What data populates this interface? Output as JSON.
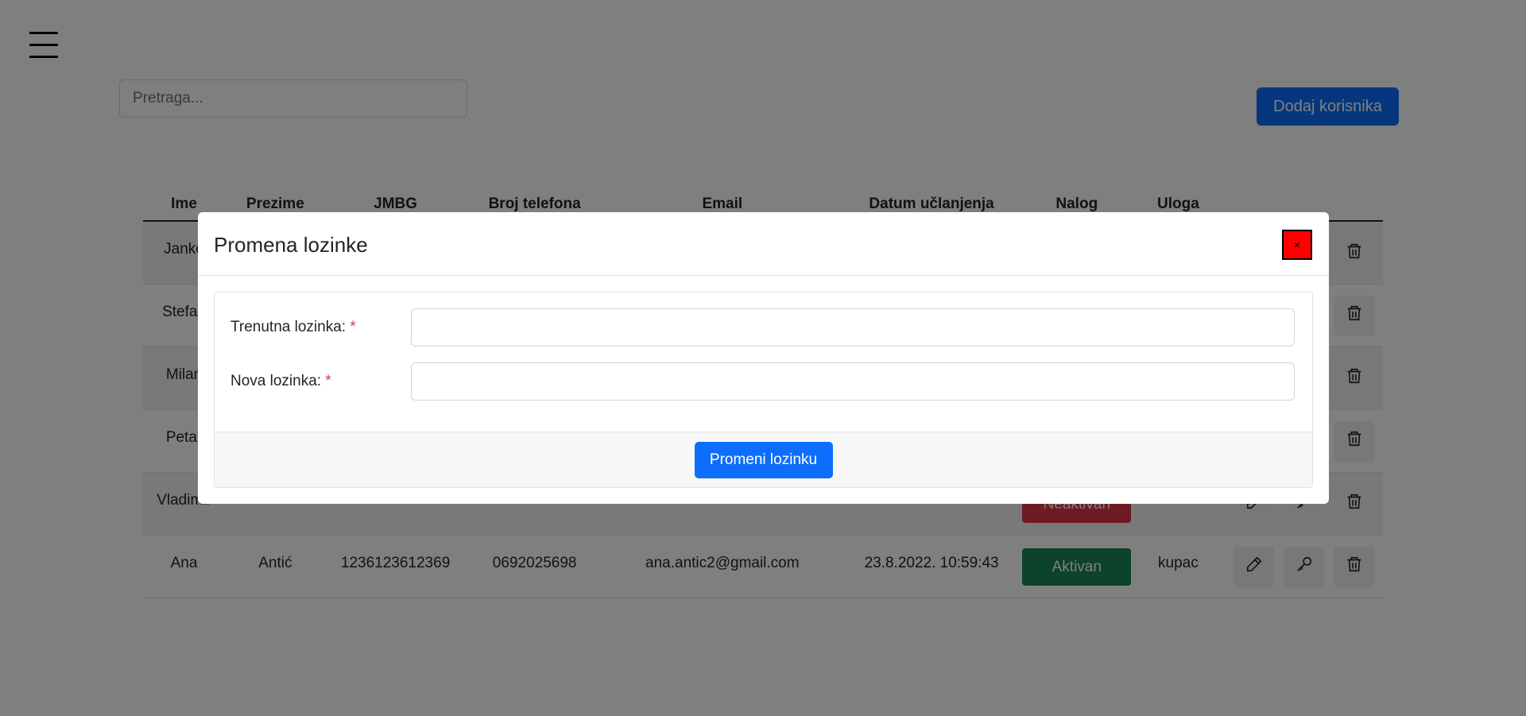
{
  "page": {
    "menu_icon": "hamburger-icon",
    "search_placeholder": "Pretraga...",
    "add_user_label": "Dodaj korisnika"
  },
  "table": {
    "headers": [
      "Ime",
      "Prezime",
      "JMBG",
      "Broj telefona",
      "Email",
      "Datum učlanjenja",
      "Nalog",
      "Uloga",
      ""
    ],
    "rows": [
      {
        "ime": "Janko",
        "prezime": "",
        "jmbg": "",
        "telefon": "",
        "email": "",
        "datum": "",
        "nalog": "",
        "uloga": ""
      },
      {
        "ime": "Stefan",
        "prezime": "",
        "jmbg": "",
        "telefon": "",
        "email": "",
        "datum": "",
        "nalog": "",
        "uloga": ""
      },
      {
        "ime": "Milan",
        "prezime": "",
        "jmbg": "",
        "telefon": "",
        "email": "",
        "datum": "",
        "nalog": "",
        "uloga": ""
      },
      {
        "ime": "Petar",
        "prezime": "",
        "jmbg": "",
        "telefon": "",
        "email": "",
        "datum": "",
        "nalog": "",
        "uloga": ""
      },
      {
        "ime": "Vladimir",
        "prezime": "",
        "jmbg": "",
        "telefon": "",
        "email": "",
        "datum": "",
        "nalog": "Neaktivan",
        "uloga": ""
      },
      {
        "ime": "Ana",
        "prezime": "Antić",
        "jmbg": "1236123612369",
        "telefon": "0692025698",
        "email": "ana.antic2@gmail.com",
        "datum": "23.8.2022. 10:59:43",
        "nalog": "Aktivan",
        "uloga": "kupac"
      }
    ],
    "action_icons": [
      "pencil-icon",
      "key-icon",
      "trash-icon"
    ]
  },
  "modal": {
    "title": "Promena lozinke",
    "close_label": "×",
    "current_password_label": "Trenutna lozinka:",
    "new_password_label": "Nova lozinka:",
    "required_mark": "*",
    "submit_label": "Promeni lozinku"
  },
  "colors": {
    "primary": "#0d6efd",
    "active": "#198754",
    "inactive": "#dc3545",
    "close_button": "#ff0000"
  }
}
